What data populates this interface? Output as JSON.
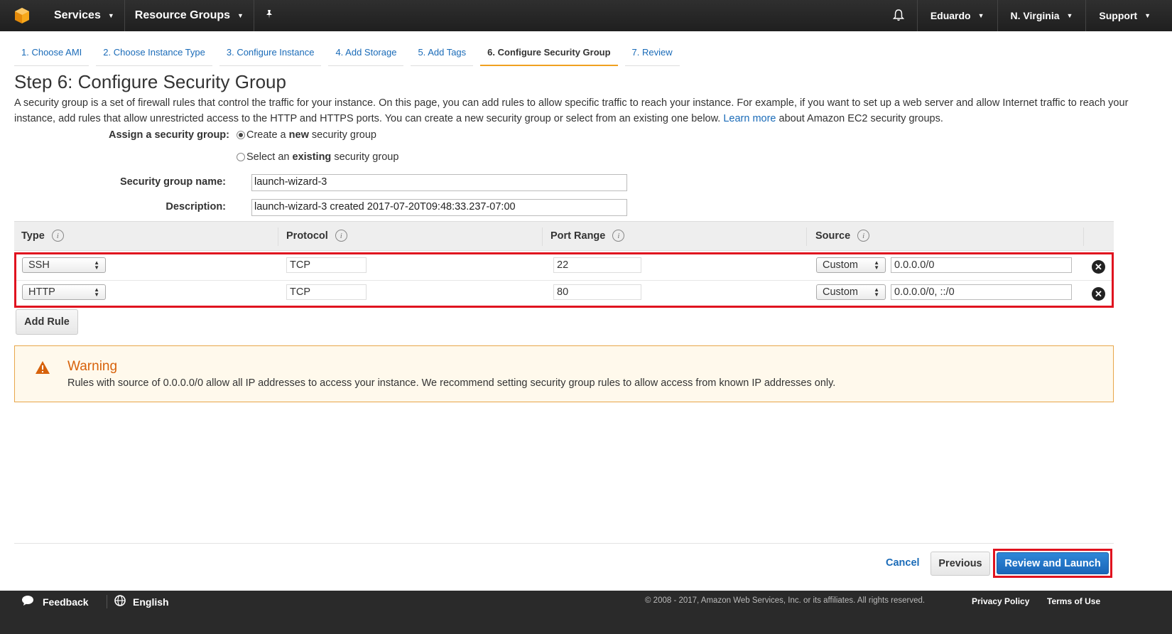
{
  "nav": {
    "services_label": "Services",
    "resource_groups_label": "Resource Groups",
    "user_label": "Eduardo",
    "region_label": "N. Virginia",
    "support_label": "Support"
  },
  "wizard_tabs": [
    {
      "label": "1. Choose AMI"
    },
    {
      "label": "2. Choose Instance Type"
    },
    {
      "label": "3. Configure Instance"
    },
    {
      "label": "4. Add Storage"
    },
    {
      "label": "5. Add Tags"
    },
    {
      "label": "6. Configure Security Group",
      "active": true
    },
    {
      "label": "7. Review"
    }
  ],
  "page": {
    "title": "Step 6: Configure Security Group",
    "intro_text": "A security group is a set of firewall rules that control the traffic for your instance. On this page, you can add rules to allow specific traffic to reach your instance. For example, if you want to set up a web server and allow Internet traffic to reach your instance, add rules that allow unrestricted access to the HTTP and HTTPS ports. You can create a new security group or select from an existing one below.",
    "learn_more": "Learn more",
    "intro_suffix": "about Amazon EC2 security groups."
  },
  "form": {
    "assign_label": "Assign a security group:",
    "option_new_prefix": "Create a ",
    "option_new_bold": "new",
    "option_new_suffix": " security group",
    "option_existing_prefix": "Select an ",
    "option_existing_bold": "existing",
    "option_existing_suffix": " security group",
    "name_label": "Security group name:",
    "name_value": "launch-wizard-3",
    "description_label": "Description:",
    "description_value": "launch-wizard-3 created 2017-07-20T09:48:33.237-07:00"
  },
  "rules_table": {
    "columns": [
      "Type",
      "Protocol",
      "Port Range",
      "Source"
    ],
    "rows": [
      {
        "type": "SSH",
        "protocol": "TCP",
        "port": "22",
        "source_mode": "Custom",
        "source": "0.0.0.0/0"
      },
      {
        "type": "HTTP",
        "protocol": "TCP",
        "port": "80",
        "source_mode": "Custom",
        "source": "0.0.0.0/0, ::/0"
      }
    ],
    "add_rule_label": "Add Rule"
  },
  "warning": {
    "title": "Warning",
    "text": "Rules with source of 0.0.0.0/0 allow all IP addresses to access your instance. We recommend setting security group rules to allow access from known IP addresses only."
  },
  "actions": {
    "cancel_label": "Cancel",
    "previous_label": "Previous",
    "launch_label": "Review and Launch"
  },
  "footer": {
    "feedback_label": "Feedback",
    "language_label": "English",
    "copyright": "© 2008 - 2017, Amazon Web Services, Inc. or its affiliates. All rights reserved.",
    "privacy_label": "Privacy Policy",
    "terms_label": "Terms of Use"
  },
  "colors": {
    "nav_bg": "#232f3e",
    "link": "#1a6bb8",
    "highlight_red": "#e0131f",
    "warning_orange": "#d7620b",
    "primary_blue": "#1b66b8"
  }
}
